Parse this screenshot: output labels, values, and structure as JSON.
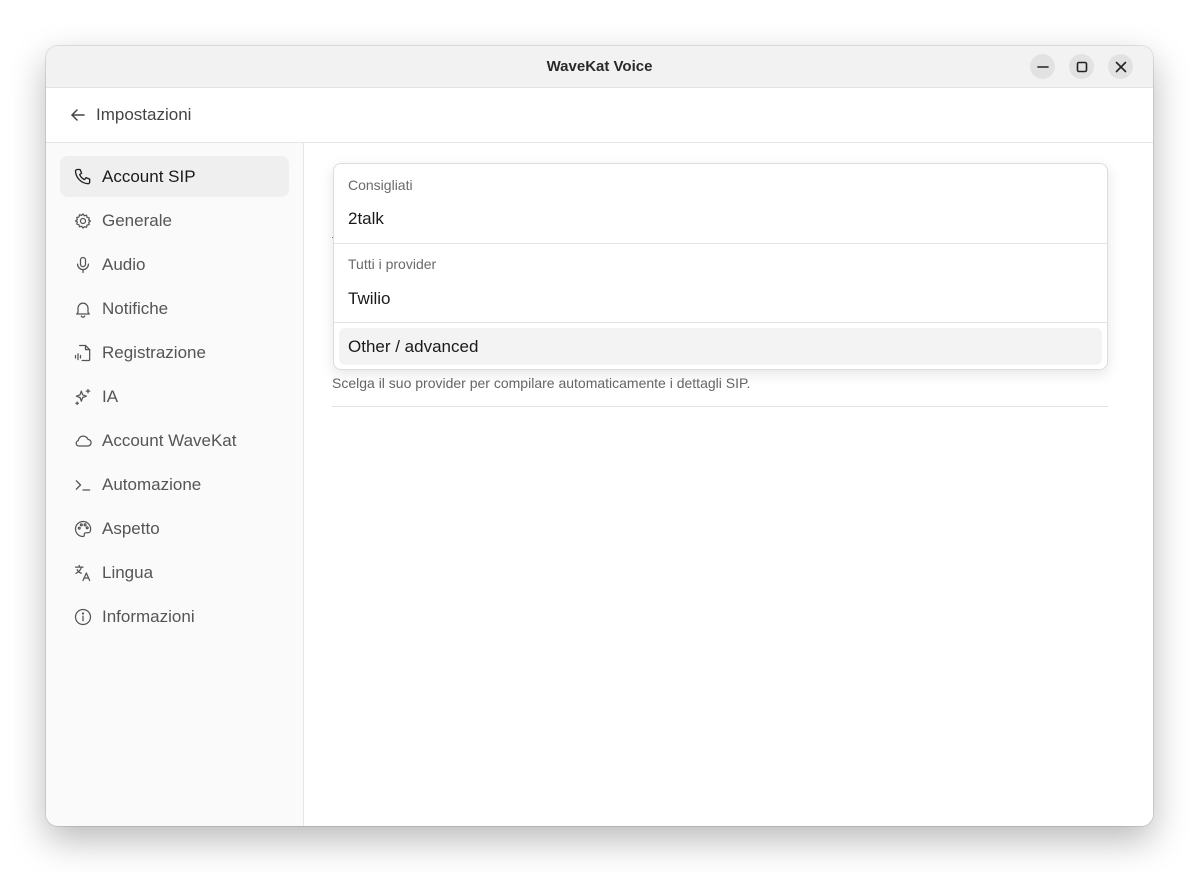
{
  "window": {
    "title": "WaveKat Voice"
  },
  "header": {
    "back_label": "Impostazioni"
  },
  "sidebar": {
    "items": [
      {
        "label": "Account SIP",
        "icon": "phone-icon",
        "active": true
      },
      {
        "label": "Generale",
        "icon": "gear-icon",
        "active": false
      },
      {
        "label": "Audio",
        "icon": "microphone-icon",
        "active": false
      },
      {
        "label": "Notifiche",
        "icon": "bell-icon",
        "active": false
      },
      {
        "label": "Registrazione",
        "icon": "file-audio-icon",
        "active": false
      },
      {
        "label": "IA",
        "icon": "sparkles-icon",
        "active": false
      },
      {
        "label": "Account WaveKat",
        "icon": "cloud-icon",
        "active": false
      },
      {
        "label": "Automazione",
        "icon": "terminal-icon",
        "active": false
      },
      {
        "label": "Aspetto",
        "icon": "palette-icon",
        "active": false
      },
      {
        "label": "Lingua",
        "icon": "translate-icon",
        "active": false
      },
      {
        "label": "Informazioni",
        "icon": "info-icon",
        "active": false
      }
    ]
  },
  "provider_dropdown": {
    "groups": [
      {
        "label": "Consigliati",
        "options": [
          "2talk"
        ]
      },
      {
        "label": "Tutti i provider",
        "options": [
          "Twilio"
        ]
      }
    ],
    "extra_option": "Other / advanced",
    "hint": "Scelga il suo provider per compilare automaticamente i dettagli SIP."
  },
  "colors": {
    "titlebar_bg": "#f2f2f2",
    "sidebar_bg": "#fafafa",
    "active_item_bg": "#efefef",
    "highlight_bg": "#f3f3f3"
  }
}
